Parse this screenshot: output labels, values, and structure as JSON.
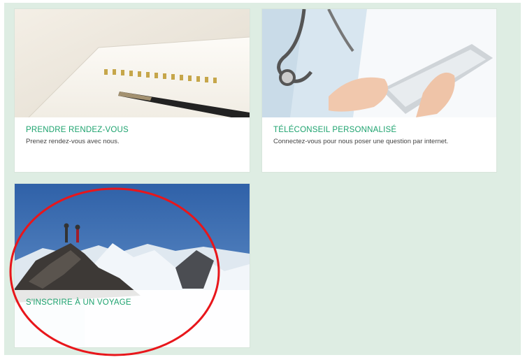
{
  "cards": [
    {
      "title": "PRENDRE RENDEZ-VOUS",
      "description": "Prenez rendez-vous avec nous.",
      "image_icon": "notebook-pen-image"
    },
    {
      "title": "TÉLÉCONSEIL PERSONNALISÉ",
      "description": "Connectez-vous pour nous poser une question par internet.",
      "image_icon": "doctor-tablet-image"
    },
    {
      "title": "S'INSCRIRE À UN VOYAGE",
      "description": "",
      "image_icon": "mountain-summit-image"
    }
  ],
  "colors": {
    "panel_bg": "#deede3",
    "title_green": "#1ea36f",
    "annotation_red": "#e8161b"
  }
}
